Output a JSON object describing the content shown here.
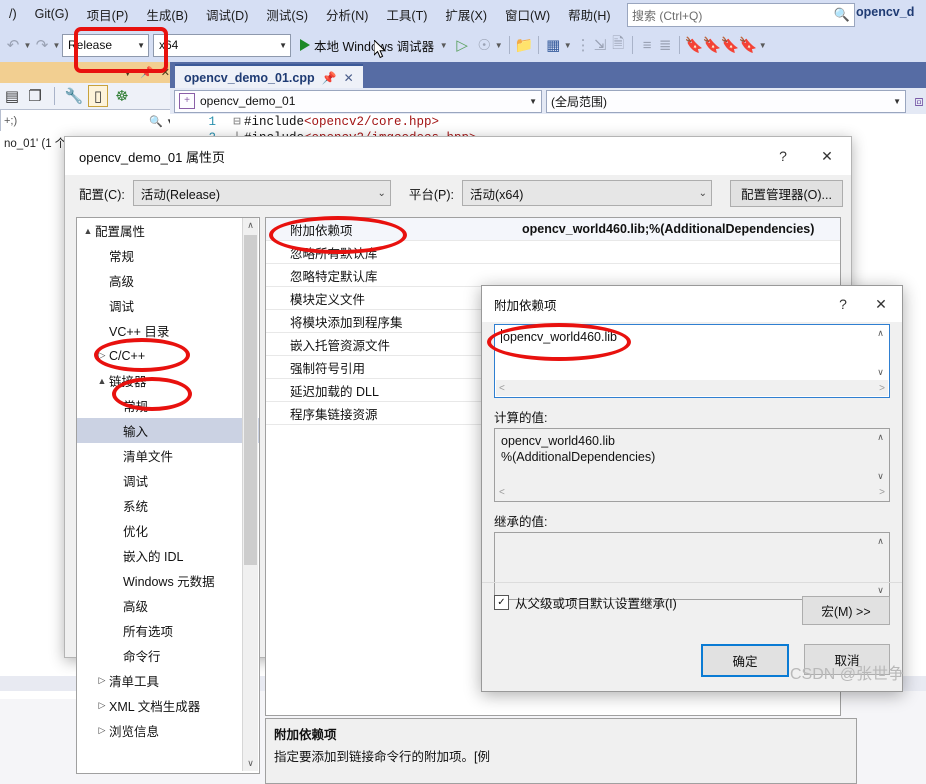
{
  "ide": {
    "menu": [
      "/)",
      "Git(G)",
      "项目(P)",
      "生成(B)",
      "调试(D)",
      "测试(S)",
      "分析(N)",
      "工具(T)",
      "扩展(X)",
      "窗口(W)",
      "帮助(H)"
    ],
    "search_placeholder": "搜索 (Ctrl+Q)",
    "solution_name": "opencv_d",
    "toolbar": {
      "config_value": "Release",
      "platform_value": "x64",
      "run_label": "本地 Windows 调试器"
    },
    "solution_explorer": {
      "search_text": "+;)",
      "tree_text": "no_01' (1 个"
    },
    "editor": {
      "tab_label": "opencv_demo_01.cpp",
      "nav_left": "opencv_demo_01",
      "nav_right": "(全局范围)",
      "code": [
        {
          "num": "1",
          "fold": "⊟",
          "text": "#include ",
          "header": "<opencv2/core.hpp>"
        },
        {
          "num": "2",
          "fold": "|",
          "text": "#include ",
          "header": "<opencv2/imgcodecs.hpp>"
        }
      ]
    }
  },
  "property_dialog": {
    "title": "opencv_demo_01 属性页",
    "help_glyph": "?",
    "close_glyph": "✕",
    "config_label": "配置(C):",
    "config_value": "活动(Release)",
    "platform_label": "平台(P):",
    "platform_value": "活动(x64)",
    "config_manager_button": "配置管理器(O)...",
    "tree": [
      {
        "label": "配置属性",
        "indent": 0,
        "arrow": "▲",
        "selected": false
      },
      {
        "label": "常规",
        "indent": 1,
        "arrow": "",
        "selected": false
      },
      {
        "label": "高级",
        "indent": 1,
        "arrow": "",
        "selected": false
      },
      {
        "label": "调试",
        "indent": 1,
        "arrow": "",
        "selected": false
      },
      {
        "label": "VC++ 目录",
        "indent": 1,
        "arrow": "",
        "selected": false
      },
      {
        "label": "C/C++",
        "indent": 1,
        "arrow": "▷",
        "selected": false
      },
      {
        "label": "链接器",
        "indent": 1,
        "arrow": "▲",
        "selected": false
      },
      {
        "label": "常规",
        "indent": 2,
        "arrow": "",
        "selected": false
      },
      {
        "label": "输入",
        "indent": 2,
        "arrow": "",
        "selected": true
      },
      {
        "label": "清单文件",
        "indent": 2,
        "arrow": "",
        "selected": false
      },
      {
        "label": "调试",
        "indent": 2,
        "arrow": "",
        "selected": false
      },
      {
        "label": "系统",
        "indent": 2,
        "arrow": "",
        "selected": false
      },
      {
        "label": "优化",
        "indent": 2,
        "arrow": "",
        "selected": false
      },
      {
        "label": "嵌入的 IDL",
        "indent": 2,
        "arrow": "",
        "selected": false
      },
      {
        "label": "Windows 元数据",
        "indent": 2,
        "arrow": "",
        "selected": false
      },
      {
        "label": "高级",
        "indent": 2,
        "arrow": "",
        "selected": false
      },
      {
        "label": "所有选项",
        "indent": 2,
        "arrow": "",
        "selected": false
      },
      {
        "label": "命令行",
        "indent": 2,
        "arrow": "",
        "selected": false
      },
      {
        "label": "清单工具",
        "indent": 1,
        "arrow": "▷",
        "selected": false
      },
      {
        "label": "XML 文档生成器",
        "indent": 1,
        "arrow": "▷",
        "selected": false
      },
      {
        "label": "浏览信息",
        "indent": 1,
        "arrow": "▷",
        "selected": false
      }
    ],
    "properties": [
      {
        "name": "附加依赖项",
        "value": "opencv_world460.lib;%(AdditionalDependencies)",
        "selected": true
      },
      {
        "name": "忽略所有默认库",
        "value": "",
        "selected": false
      },
      {
        "name": "忽略特定默认库",
        "value": "",
        "selected": false
      },
      {
        "name": "模块定义文件",
        "value": "",
        "selected": false
      },
      {
        "name": "将模块添加到程序集",
        "value": "",
        "selected": false
      },
      {
        "name": "嵌入托管资源文件",
        "value": "",
        "selected": false
      },
      {
        "name": "强制符号引用",
        "value": "",
        "selected": false
      },
      {
        "name": "延迟加载的 DLL",
        "value": "",
        "selected": false
      },
      {
        "name": "程序集链接资源",
        "value": "",
        "selected": false
      }
    ],
    "description": {
      "title": "附加依赖项",
      "text": "指定要添加到链接命令行的附加项。[例"
    }
  },
  "additional_dependencies_dialog": {
    "title": "附加依赖项",
    "help_glyph": "?",
    "close_glyph": "✕",
    "edit_value": "opencv_world460.lib",
    "evaluated_label": "计算的值:",
    "evaluated_value": "opencv_world460.lib\n%(AdditionalDependencies)",
    "inherited_label": "继承的值:",
    "inherited_value": "",
    "inherit_checkbox_label": "从父级或项目默认设置继承(I)",
    "inherit_checked": true,
    "macro_button": "宏(M) >>",
    "ok_button": "确定",
    "cancel_button": "取消"
  },
  "watermark": "CSDN @张世争",
  "colors": {
    "menu_bg": "#d6dff4",
    "accent_blue": "#0a7bd4",
    "annotation_red": "#e8110e",
    "selection": "#cbd2e3"
  }
}
